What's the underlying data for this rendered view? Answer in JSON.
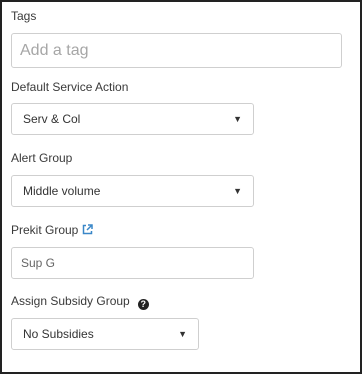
{
  "tags": {
    "label": "Tags",
    "placeholder": "Add a tag"
  },
  "default_service_action": {
    "label": "Default Service Action",
    "value": "Serv & Col"
  },
  "alert_group": {
    "label": "Alert Group",
    "value": "Middle volume"
  },
  "prekit_group": {
    "label": "Prekit Group",
    "value": "Sup G",
    "icon": "external-link-icon"
  },
  "assign_subsidy_group": {
    "label": "Assign Subsidy Group",
    "value": "No Subsidies",
    "help_icon": "question-circle-icon"
  },
  "colors": {
    "link_icon": "#3a87c8",
    "border": "#cfcfcf",
    "frame": "#222222"
  }
}
